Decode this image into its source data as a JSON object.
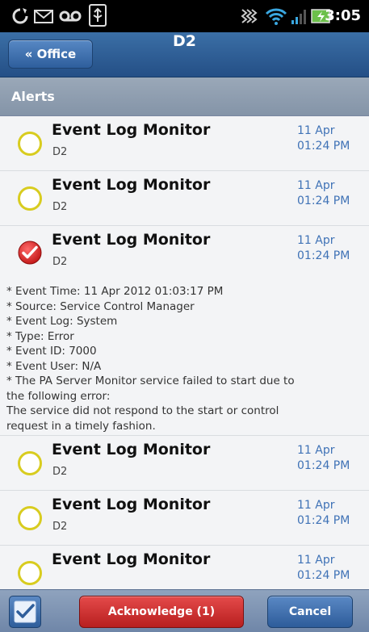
{
  "status_bar": {
    "time": "3:05",
    "icons": [
      "sync-icon",
      "mail-icon",
      "voicemail-icon",
      "usb-icon",
      "vibrate-icon",
      "wifi-icon",
      "signal-icon",
      "battery-charging-icon"
    ]
  },
  "header": {
    "back_label": "« Office",
    "title": "D2"
  },
  "section": {
    "title": "Alerts"
  },
  "alerts": [
    {
      "title": "Event Log Monitor",
      "subtitle": "D2",
      "date": "11 Apr",
      "time": "01:24 PM",
      "checked": false
    },
    {
      "title": "Event Log Monitor",
      "subtitle": "D2",
      "date": "11 Apr",
      "time": "01:24 PM",
      "checked": false
    },
    {
      "title": "Event Log Monitor",
      "subtitle": "D2",
      "date": "11 Apr",
      "time": "01:24 PM",
      "checked": true,
      "details": [
        "* Event Time: 11 Apr 2012 01:03:17 PM",
        "* Source: Service Control Manager",
        "* Event Log: System",
        "* Type: Error",
        "* Event ID: 7000",
        "* Event User: N/A",
        "* The PA Server Monitor service failed to start due to",
        "the following error:",
        "The service did not respond to the start or control",
        "request in a timely fashion."
      ]
    },
    {
      "title": "Event Log Monitor",
      "subtitle": "D2",
      "date": "11 Apr",
      "time": "01:24 PM",
      "checked": false
    },
    {
      "title": "Event Log Monitor",
      "subtitle": "D2",
      "date": "11 Apr",
      "time": "01:24 PM",
      "checked": false
    },
    {
      "title": "Event Log Monitor",
      "subtitle": "",
      "date": "11 Apr",
      "time": "01:24 PM",
      "checked": false
    }
  ],
  "footer": {
    "acknowledge_label": "Acknowledge (1)",
    "cancel_label": "Cancel"
  },
  "colors": {
    "accent_blue": "#2e5e9c",
    "acknowledge_red": "#c72828",
    "unchecked_ring": "#d8cc1f",
    "date_text": "#3f72b6"
  }
}
